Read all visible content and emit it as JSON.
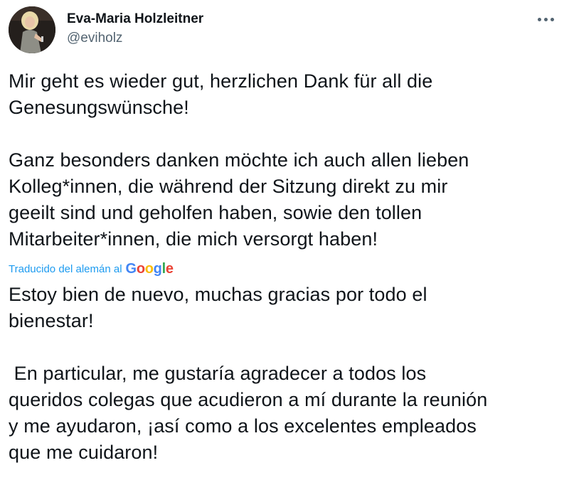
{
  "author": {
    "display_name": "Eva-Maria Holzleitner",
    "handle": "@eviholz"
  },
  "tweet": {
    "original_text": "Mir geht es wieder gut, herzlichen Dank für all die\nGenesungswünsche!\n\nGanz besonders danken möchte ich auch allen lieben\nKolleg*innen, die während der Sitzung direkt zu mir\ngeeilt sind und geholfen haben, sowie den tollen\nMitarbeiter*innen, die mich versorgt haben!",
    "translation_label": "Traducido del alemán al",
    "translation_provider": "Google",
    "translated_text": "Estoy bien de nuevo, muchas gracias por todo el\nbienestar!\n\n En particular, me gustaría agradecer a todos los\nqueridos colegas que acudieron a mí durante la reunión\ny me ayudaron, ¡así como a los excelentes empleados\nque me cuidaron!"
  },
  "icons": {
    "more": "more-horizontal-icon",
    "avatar": "profile-photo"
  },
  "colors": {
    "text": "#0f1419",
    "secondary": "#536471",
    "link": "#1d9bf0"
  }
}
